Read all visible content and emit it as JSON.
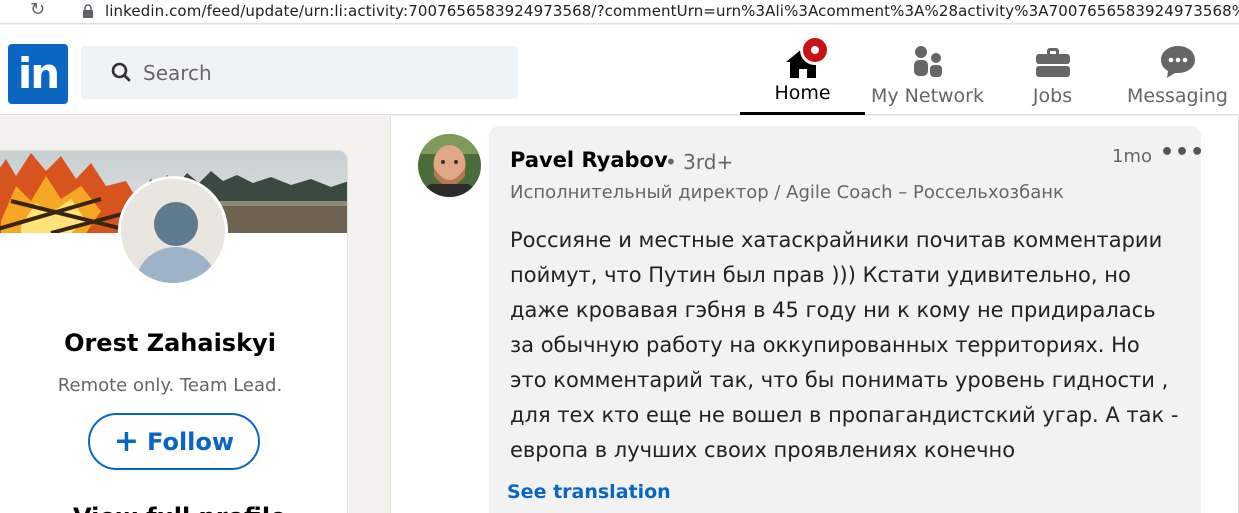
{
  "browser": {
    "url": "linkedin.com/feed/update/urn:li:activity:7007656583924973568/?commentUrn=urn%3Ali%3Acomment%3A%28activity%3A7007656583924973568%"
  },
  "header": {
    "logo_text": "in",
    "search_placeholder": "Search",
    "nav": {
      "home": "Home",
      "network": "My Network",
      "jobs": "Jobs",
      "messaging": "Messaging"
    }
  },
  "profile": {
    "name": "Orest Zahaiskyi",
    "headline": "Remote only. Team Lead.",
    "follow_label": "Follow",
    "view_full_profile": "View full profile"
  },
  "comment": {
    "author": "Pavel Ryabov",
    "degree": "• 3rd+",
    "time": "1mo",
    "menu": "•••",
    "headline": "Исполнительный директор / Agile Coach – Россельхозбанк",
    "lines": [
      "Россияне и местные хатаскрайники почитав комментарии",
      "поймут, что Путин был прав ))) Кстати удивительно, но",
      "даже кровавая гэбня в 45 году ни к кому не придиралась",
      "за обычную работу на оккупированных территориях. Но",
      "это комментарий так, что бы понимать уровень гидности ,",
      "для тех кто еще не вошел в пропагандистский угар. А так -",
      "европа в лучших своих проявлениях конечно"
    ],
    "see_translation": "See translation"
  },
  "colors": {
    "brand": "#0a66c2",
    "notification": "#cc1016",
    "bubble": "#f2f2f2"
  },
  "icons": [
    "reload-icon",
    "lock-icon",
    "search-icon",
    "home-icon",
    "network-icon",
    "jobs-icon",
    "messaging-icon",
    "plus-icon",
    "more-icon"
  ]
}
